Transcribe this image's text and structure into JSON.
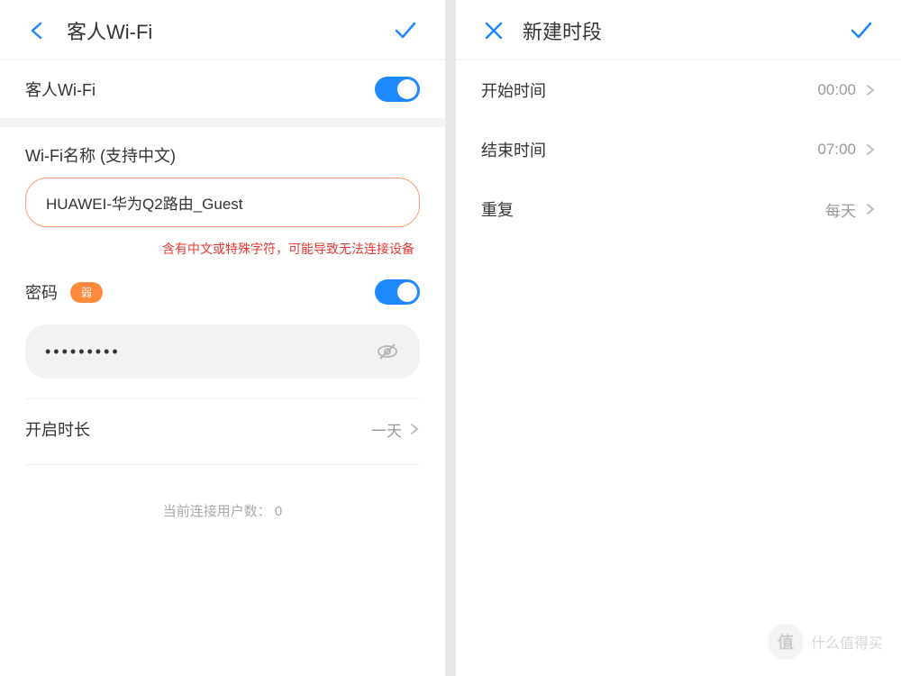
{
  "left": {
    "header": {
      "title": "客人Wi-Fi"
    },
    "guest_wifi": {
      "label": "客人Wi-Fi",
      "enabled": true
    },
    "wifi_name": {
      "label": "Wi-Fi名称 (支持中文)",
      "value": "HUAWEI-华为Q2路由_Guest",
      "warning": "含有中文或特殊字符，可能导致无法连接设备"
    },
    "password": {
      "label": "密码",
      "strength": "弱",
      "enabled": true,
      "masked": "•••••••••"
    },
    "duration": {
      "label": "开启时长",
      "value": "一天"
    },
    "connected": {
      "label": "当前连接用户数：",
      "count": "0"
    }
  },
  "right": {
    "header": {
      "title": "新建时段"
    },
    "start": {
      "label": "开始时间",
      "value": "00:00"
    },
    "end": {
      "label": "结束时间",
      "value": "07:00"
    },
    "repeat": {
      "label": "重复",
      "value": "每天"
    }
  },
  "watermark": {
    "badge": "值",
    "text": "什么值得买"
  }
}
